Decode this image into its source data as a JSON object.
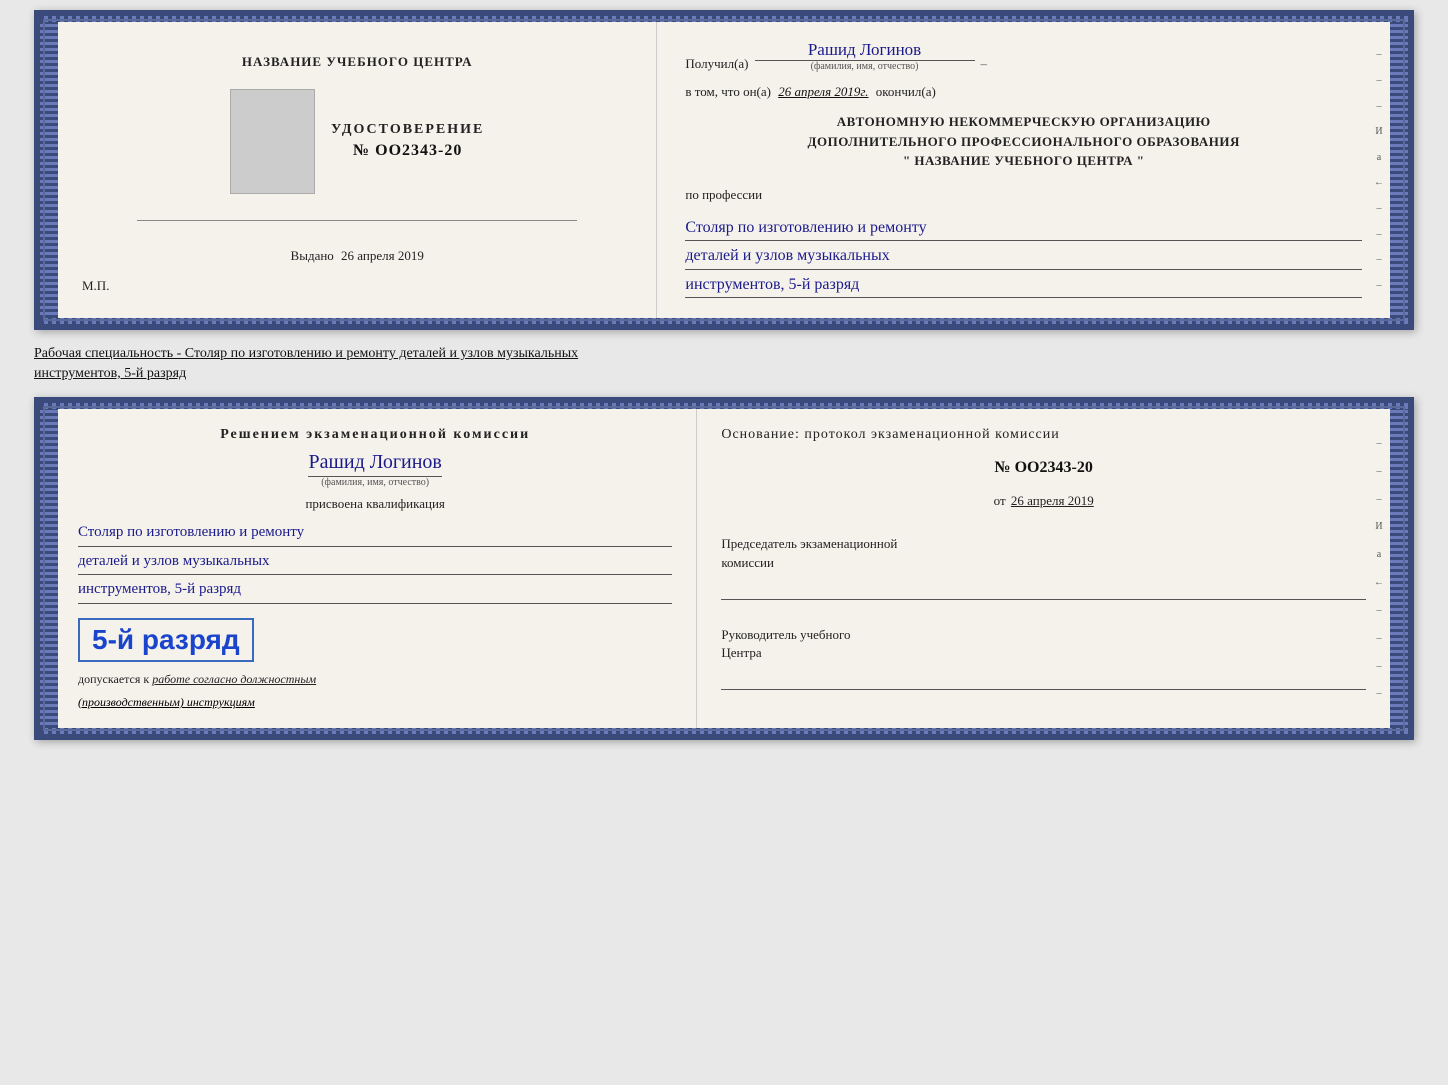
{
  "page": {
    "background_color": "#e8e8e8"
  },
  "top_card": {
    "left": {
      "school_name": "НАЗВАНИЕ УЧЕБНОГО ЦЕНТРА",
      "udostoverenie_title": "УДОСТОВЕРЕНИЕ",
      "number": "№ OO2343-20",
      "vydano_label": "Выдано",
      "vydano_date": "26 апреля 2019",
      "mp_label": "М.П."
    },
    "right": {
      "poluchil_label": "Получил(а)",
      "recipient_name": "Рашид Логинов",
      "fio_subtitle": "(фамилия, имя, отчество)",
      "dash": "–",
      "v_tom_label": "в том, что он(а)",
      "date_value": "26 апреля 2019г.",
      "okonchil_label": "окончил(а)",
      "org_line1": "АВТОНОМНУЮ НЕКОММЕРЧЕСКУЮ ОРГАНИЗАЦИЮ",
      "org_line2": "ДОПОЛНИТЕЛЬНОГО ПРОФЕССИОНАЛЬНОГО ОБРАЗОВАНИЯ",
      "org_line3": "\"  НАЗВАНИЕ УЧЕБНОГО ЦЕНТРА  \"",
      "po_professii": "по профессии",
      "profession_line1": "Столяр по изготовлению и ремонту",
      "profession_line2": "деталей и узлов музыкальных",
      "profession_line3": "инструментов, 5-й разряд"
    }
  },
  "specialty_text": {
    "label": "Рабочая специальность - Столяр по изготовлению и ремонту деталей и узлов музыкальных",
    "label2": "инструментов, 5-й разряд"
  },
  "bottom_card": {
    "left": {
      "resheniem_label": "Решением экзаменационной комиссии",
      "candidate_name": "Рашид Логинов",
      "fio_subtitle": "(фамилия, имя, отчество)",
      "prisvoyena_label": "присвоена квалификация",
      "qualification_line1": "Столяр по изготовлению и ремонту",
      "qualification_line2": "деталей и узлов музыкальных",
      "qualification_line3": "инструментов, 5-й разряд",
      "razryad_highlight": "5-й разряд",
      "dopusk_label": "допускается к",
      "dopusk_value": "работе согласно должностным",
      "dopusk_value2": "(производственным) инструкциям"
    },
    "right": {
      "osnovanie_label": "Основание: протокол экзаменационной комиссии",
      "protocol_num": "№ OO2343-20",
      "ot_label": "от",
      "ot_date": "26 апреля 2019",
      "predsedatel_label": "Председатель экзаменационной",
      "predsedatel_label2": "комиссии",
      "rukovoditel_label": "Руководитель учебного",
      "rukovoditel_label2": "Центра",
      "dash_items": [
        "–",
        "–",
        "–",
        "И",
        "а",
        "←",
        "–",
        "–",
        "–",
        "–",
        "–"
      ]
    }
  }
}
